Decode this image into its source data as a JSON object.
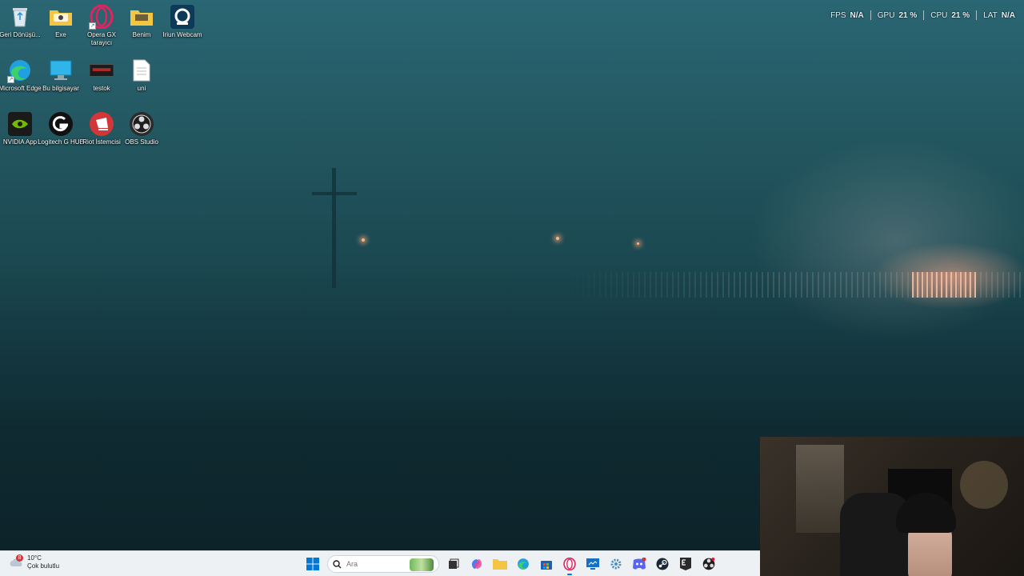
{
  "desktop": {
    "icons": [
      {
        "name": "recycle-bin",
        "label": "Geri Dönüşü...",
        "icon": "recycle-bin-icon"
      },
      {
        "name": "exe-folder",
        "label": "Exe",
        "icon": "folder-icon"
      },
      {
        "name": "opera-gx",
        "label": "Opera GX tarayıcı",
        "icon": "opera-gx-icon"
      },
      {
        "name": "benim-folder",
        "label": "Benim",
        "icon": "folder-icon"
      },
      {
        "name": "iriun-webcam",
        "label": "Iriun Webcam",
        "icon": "webcam-icon"
      },
      {
        "name": "microsoft-edge",
        "label": "Microsoft Edge",
        "icon": "edge-icon"
      },
      {
        "name": "this-pc",
        "label": "Bu bilgisayar",
        "icon": "computer-icon"
      },
      {
        "name": "testok",
        "label": "testok",
        "icon": "image-file-icon"
      },
      {
        "name": "uni",
        "label": "uni",
        "icon": "text-file-icon"
      },
      {
        "name": "nvidia-app",
        "label": "NVIDIA App",
        "icon": "nvidia-icon"
      },
      {
        "name": "logitech-g-hub",
        "label": "Logitech G HUB",
        "icon": "logitech-icon"
      },
      {
        "name": "riot-client",
        "label": "Riot İstemcisi",
        "icon": "riot-icon"
      },
      {
        "name": "obs-studio",
        "label": "OBS Studio",
        "icon": "obs-icon"
      }
    ]
  },
  "perf_overlay": {
    "fps_label": "FPS",
    "fps_value": "N/A",
    "gpu_label": "GPU",
    "gpu_value": "21 %",
    "cpu_label": "CPU",
    "cpu_value": "21 %",
    "lat_label": "LAT",
    "lat_value": "N/A"
  },
  "taskbar": {
    "weather": {
      "temp": "10°C",
      "condition": "Çok bulutlu",
      "badge": "8"
    },
    "search": {
      "placeholder": "Ara"
    },
    "apps": [
      {
        "name": "start-button",
        "icon": "windows-icon"
      },
      {
        "name": "search-box",
        "icon": "search-icon"
      },
      {
        "name": "task-view",
        "icon": "task-view-icon"
      },
      {
        "name": "copilot",
        "icon": "copilot-icon"
      },
      {
        "name": "file-explorer",
        "icon": "folder-icon"
      },
      {
        "name": "edge",
        "icon": "edge-icon"
      },
      {
        "name": "store",
        "icon": "store-icon"
      },
      {
        "name": "opera-gx",
        "icon": "opera-gx-icon"
      },
      {
        "name": "remote-desktop",
        "icon": "remote-desktop-icon"
      },
      {
        "name": "settings",
        "icon": "gear-icon"
      },
      {
        "name": "discord",
        "icon": "discord-icon"
      },
      {
        "name": "steam",
        "icon": "steam-icon"
      },
      {
        "name": "epic-games",
        "icon": "epic-games-icon"
      },
      {
        "name": "obs",
        "icon": "obs-icon"
      }
    ]
  },
  "colors": {
    "taskbar_bg": "#eef1f4",
    "accent": "#0078d4",
    "badge": "#d13438"
  }
}
